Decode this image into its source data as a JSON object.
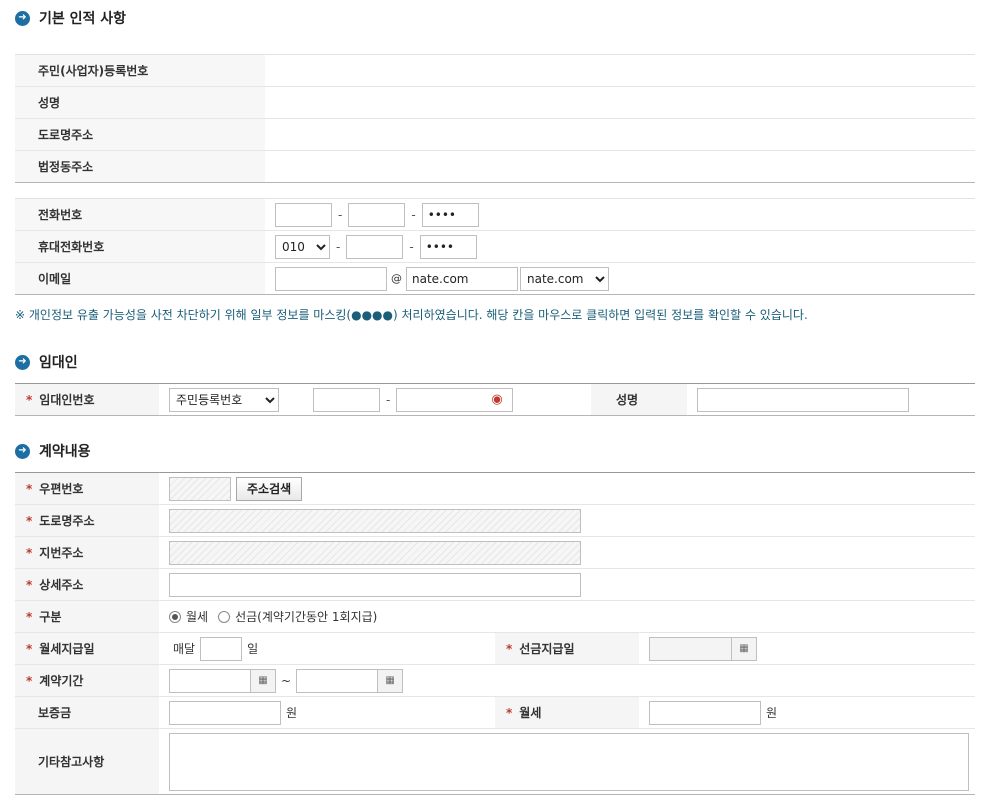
{
  "sections": {
    "basic": "기본 인적 사항",
    "landlord": "임대인",
    "contract": "계약내용"
  },
  "basic": {
    "id_label": "주민(사업자)등록번호",
    "name_label": "성명",
    "road_label": "도로명주소",
    "legal_label": "법정동주소",
    "phone_label": "전화번호",
    "phone1": "",
    "phone2": "",
    "phone3": "••••",
    "mobile_label": "휴대전화번호",
    "mobile_prefix": "010",
    "mobile2": "",
    "mobile3": "••••",
    "email_label": "이메일",
    "email_id": "",
    "email_at": "@",
    "email_domain": "nate.com",
    "email_select": "nate.com"
  },
  "notice": "※ 개인정보 유출 가능성을 사전 차단하기 위해 일부 정보를 마스킹(●●●●) 처리하였습니다. 해당 칸을 마우스로 클릭하면 입력된 정보를 확인할 수 있습니다.",
  "landlord": {
    "id_label": "임대인번호",
    "id_type": "주민등록번호",
    "name_label": "성명"
  },
  "contract": {
    "zip_label": "우편번호",
    "search_button": "주소검색",
    "road_label": "도로명주소",
    "jibun_label": "지번주소",
    "detail_label": "상세주소",
    "type_label": "구분",
    "type_monthly": "월세",
    "type_prepaid": "선금(계약기간동안 1회지급)",
    "payday_label": "월세지급일",
    "payday_prefix": "매달",
    "payday_suffix": "일",
    "prepaid_date_label": "선금지급일",
    "period_label": "계약기간",
    "period_sep": "~",
    "deposit_label": "보증금",
    "won": "원",
    "rent_label": "월세",
    "memo_label": "기타참고사항"
  },
  "required_mark": "*",
  "calendar_glyph": "▦",
  "arrow_glyph": "➜"
}
